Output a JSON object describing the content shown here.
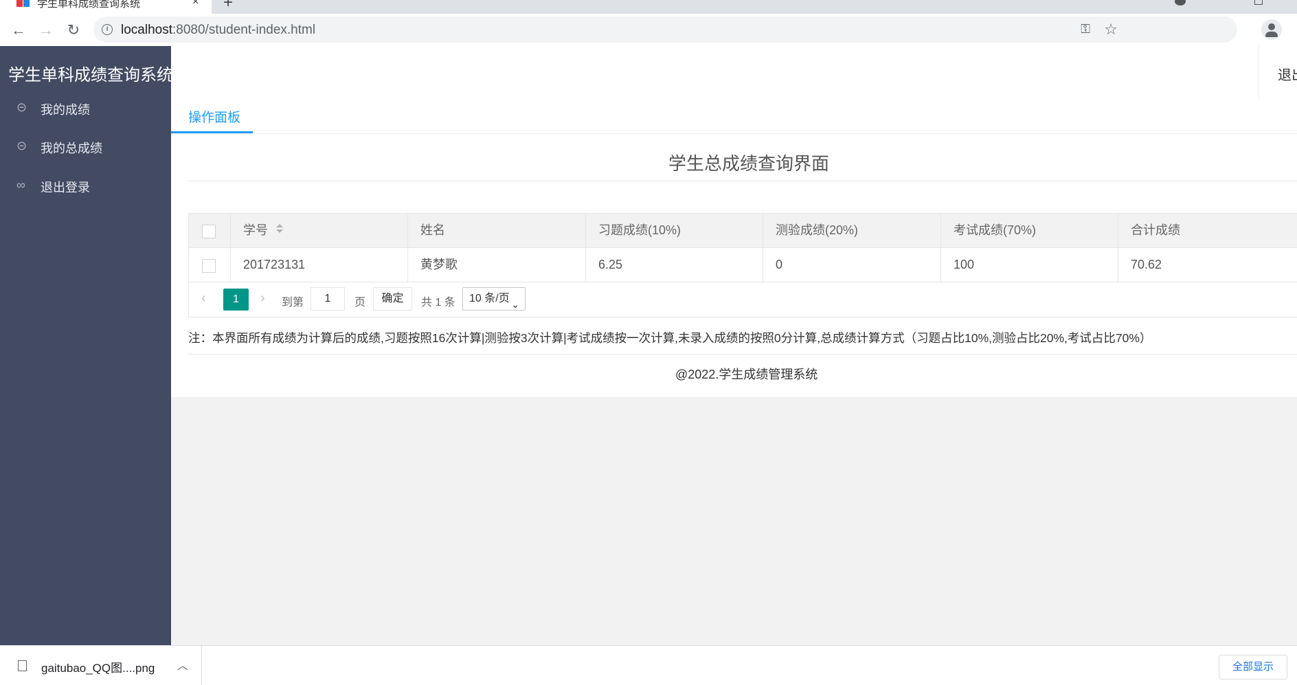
{
  "browser": {
    "tab_title": "学生单科成绩查询系统",
    "close_glyph": "×",
    "new_tab_glyph": "+",
    "url_host": "localhost",
    "url_rest": ":8080/student-index.html",
    "back_glyph": "←",
    "forward_glyph": "→",
    "reload_glyph": "↻"
  },
  "sidebar": {
    "logo": "学生单科成绩查询系统",
    "items": [
      {
        "label": "我的成绩",
        "icon": "link-icon"
      },
      {
        "label": "我的总成绩",
        "icon": "link-icon"
      },
      {
        "label": "退出登录",
        "icon": "unlink-icon"
      }
    ]
  },
  "header": {
    "logout": "退出"
  },
  "tabs": [
    {
      "label": "操作面板",
      "active": true
    }
  ],
  "main": {
    "title": "学生总成绩查询界面",
    "table": {
      "columns": [
        "学号",
        "姓名",
        "习题成绩(10%)",
        "测验成绩(20%)",
        "考试成绩(70%)",
        "合计成绩"
      ],
      "rows": [
        [
          "201723131",
          "黄梦歌",
          "6.25",
          "0",
          "100",
          "70.62"
        ]
      ]
    },
    "pager": {
      "current_page": "1",
      "goto_label": "到第",
      "goto_value": "1",
      "page_unit": "页",
      "confirm": "确定",
      "total": "共 1 条",
      "page_size": "10 条/页"
    },
    "note": "注：本界面所有成绩为计算后的成绩,习题按照16次计算|测验按3次计算|考试成绩按一次计算,未录入成绩的按照0分计算,总成绩计算方式（习题占比10%,测验占比20%,考试占比70%）",
    "footer": "@2022.学生成绩管理系统"
  },
  "downloads": {
    "file_name": "gaitubao_QQ图....png",
    "show_all": "全部显示"
  },
  "colors": {
    "sidebar_bg": "#434b63",
    "accent_blue": "#1e9fff",
    "pager_active": "#009688"
  }
}
